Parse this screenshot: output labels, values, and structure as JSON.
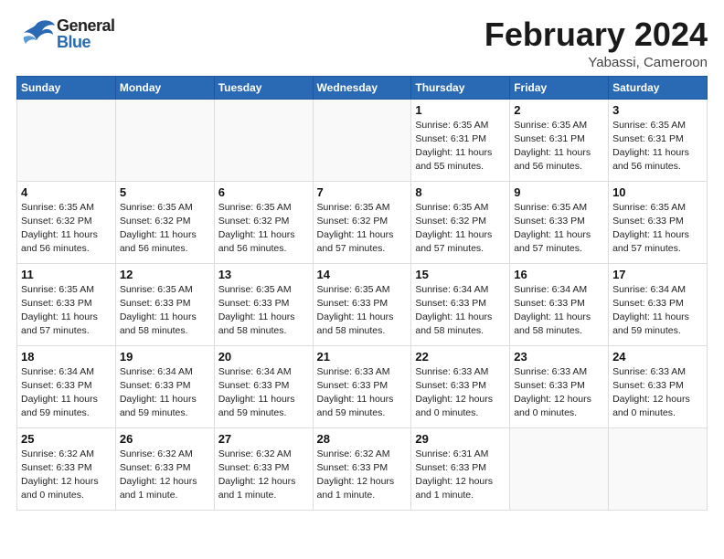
{
  "header": {
    "logo_general": "General",
    "logo_blue": "Blue",
    "title": "February 2024",
    "location": "Yabassi, Cameroon"
  },
  "calendar": {
    "days_of_week": [
      "Sunday",
      "Monday",
      "Tuesday",
      "Wednesday",
      "Thursday",
      "Friday",
      "Saturday"
    ],
    "weeks": [
      [
        {
          "day": "",
          "info": ""
        },
        {
          "day": "",
          "info": ""
        },
        {
          "day": "",
          "info": ""
        },
        {
          "day": "",
          "info": ""
        },
        {
          "day": "1",
          "info": "Sunrise: 6:35 AM\nSunset: 6:31 PM\nDaylight: 11 hours\nand 55 minutes."
        },
        {
          "day": "2",
          "info": "Sunrise: 6:35 AM\nSunset: 6:31 PM\nDaylight: 11 hours\nand 56 minutes."
        },
        {
          "day": "3",
          "info": "Sunrise: 6:35 AM\nSunset: 6:31 PM\nDaylight: 11 hours\nand 56 minutes."
        }
      ],
      [
        {
          "day": "4",
          "info": "Sunrise: 6:35 AM\nSunset: 6:32 PM\nDaylight: 11 hours\nand 56 minutes."
        },
        {
          "day": "5",
          "info": "Sunrise: 6:35 AM\nSunset: 6:32 PM\nDaylight: 11 hours\nand 56 minutes."
        },
        {
          "day": "6",
          "info": "Sunrise: 6:35 AM\nSunset: 6:32 PM\nDaylight: 11 hours\nand 56 minutes."
        },
        {
          "day": "7",
          "info": "Sunrise: 6:35 AM\nSunset: 6:32 PM\nDaylight: 11 hours\nand 57 minutes."
        },
        {
          "day": "8",
          "info": "Sunrise: 6:35 AM\nSunset: 6:32 PM\nDaylight: 11 hours\nand 57 minutes."
        },
        {
          "day": "9",
          "info": "Sunrise: 6:35 AM\nSunset: 6:33 PM\nDaylight: 11 hours\nand 57 minutes."
        },
        {
          "day": "10",
          "info": "Sunrise: 6:35 AM\nSunset: 6:33 PM\nDaylight: 11 hours\nand 57 minutes."
        }
      ],
      [
        {
          "day": "11",
          "info": "Sunrise: 6:35 AM\nSunset: 6:33 PM\nDaylight: 11 hours\nand 57 minutes."
        },
        {
          "day": "12",
          "info": "Sunrise: 6:35 AM\nSunset: 6:33 PM\nDaylight: 11 hours\nand 58 minutes."
        },
        {
          "day": "13",
          "info": "Sunrise: 6:35 AM\nSunset: 6:33 PM\nDaylight: 11 hours\nand 58 minutes."
        },
        {
          "day": "14",
          "info": "Sunrise: 6:35 AM\nSunset: 6:33 PM\nDaylight: 11 hours\nand 58 minutes."
        },
        {
          "day": "15",
          "info": "Sunrise: 6:34 AM\nSunset: 6:33 PM\nDaylight: 11 hours\nand 58 minutes."
        },
        {
          "day": "16",
          "info": "Sunrise: 6:34 AM\nSunset: 6:33 PM\nDaylight: 11 hours\nand 58 minutes."
        },
        {
          "day": "17",
          "info": "Sunrise: 6:34 AM\nSunset: 6:33 PM\nDaylight: 11 hours\nand 59 minutes."
        }
      ],
      [
        {
          "day": "18",
          "info": "Sunrise: 6:34 AM\nSunset: 6:33 PM\nDaylight: 11 hours\nand 59 minutes."
        },
        {
          "day": "19",
          "info": "Sunrise: 6:34 AM\nSunset: 6:33 PM\nDaylight: 11 hours\nand 59 minutes."
        },
        {
          "day": "20",
          "info": "Sunrise: 6:34 AM\nSunset: 6:33 PM\nDaylight: 11 hours\nand 59 minutes."
        },
        {
          "day": "21",
          "info": "Sunrise: 6:33 AM\nSunset: 6:33 PM\nDaylight: 11 hours\nand 59 minutes."
        },
        {
          "day": "22",
          "info": "Sunrise: 6:33 AM\nSunset: 6:33 PM\nDaylight: 12 hours\nand 0 minutes."
        },
        {
          "day": "23",
          "info": "Sunrise: 6:33 AM\nSunset: 6:33 PM\nDaylight: 12 hours\nand 0 minutes."
        },
        {
          "day": "24",
          "info": "Sunrise: 6:33 AM\nSunset: 6:33 PM\nDaylight: 12 hours\nand 0 minutes."
        }
      ],
      [
        {
          "day": "25",
          "info": "Sunrise: 6:32 AM\nSunset: 6:33 PM\nDaylight: 12 hours\nand 0 minutes."
        },
        {
          "day": "26",
          "info": "Sunrise: 6:32 AM\nSunset: 6:33 PM\nDaylight: 12 hours\nand 1 minute."
        },
        {
          "day": "27",
          "info": "Sunrise: 6:32 AM\nSunset: 6:33 PM\nDaylight: 12 hours\nand 1 minute."
        },
        {
          "day": "28",
          "info": "Sunrise: 6:32 AM\nSunset: 6:33 PM\nDaylight: 12 hours\nand 1 minute."
        },
        {
          "day": "29",
          "info": "Sunrise: 6:31 AM\nSunset: 6:33 PM\nDaylight: 12 hours\nand 1 minute."
        },
        {
          "day": "",
          "info": ""
        },
        {
          "day": "",
          "info": ""
        }
      ]
    ]
  }
}
